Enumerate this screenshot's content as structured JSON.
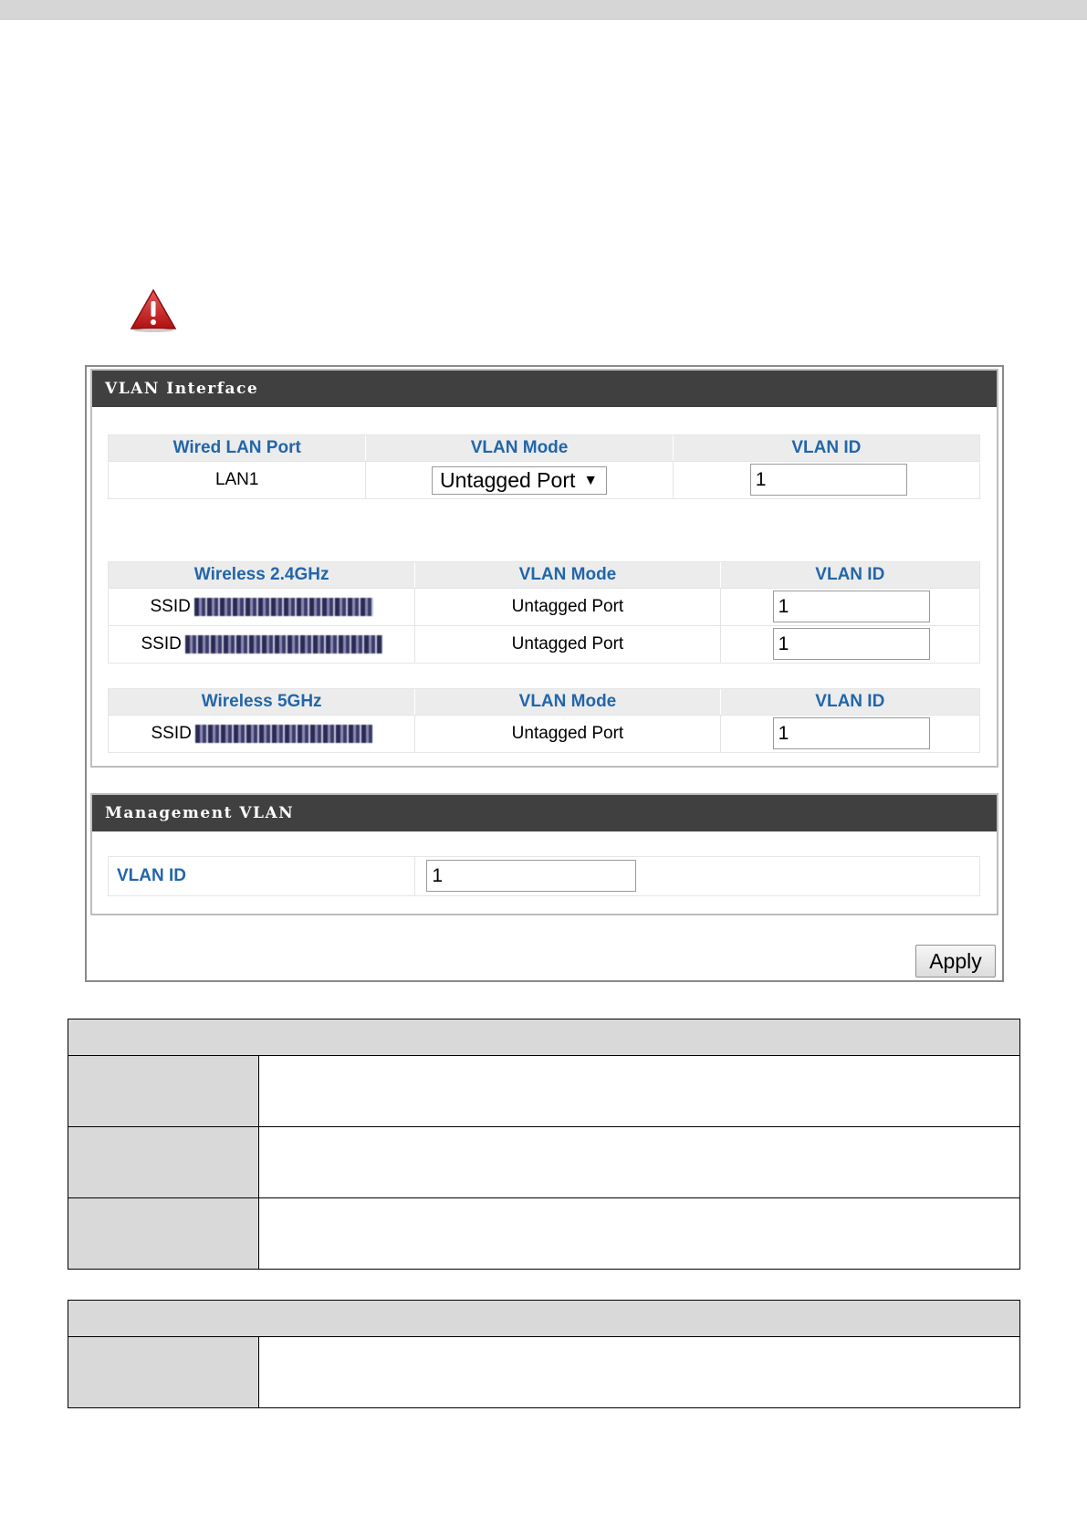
{
  "vlan_interface": {
    "title": "VLAN Interface",
    "wired": {
      "headers": [
        "Wired LAN Port",
        "VLAN Mode",
        "VLAN ID"
      ],
      "rows": [
        {
          "port": "LAN1",
          "mode": "Untagged Port",
          "vlan_id": "1"
        }
      ]
    },
    "wireless_24": {
      "headers": [
        "Wireless 2.4GHz",
        "VLAN Mode",
        "VLAN ID"
      ],
      "rows": [
        {
          "ssid_prefix": "SSID",
          "mode": "Untagged Port",
          "vlan_id": "1"
        },
        {
          "ssid_prefix": "SSID",
          "mode": "Untagged Port",
          "vlan_id": "1"
        }
      ]
    },
    "wireless_5": {
      "headers": [
        "Wireless 5GHz",
        "VLAN Mode",
        "VLAN ID"
      ],
      "rows": [
        {
          "ssid_prefix": "SSID",
          "mode": "Untagged Port",
          "vlan_id": "1"
        }
      ]
    }
  },
  "management_vlan": {
    "title": "Management VLAN",
    "label": "VLAN ID",
    "vlan_id": "1"
  },
  "apply_label": "Apply",
  "icons": {
    "warning": "warning-icon",
    "dropdown": "dropdown-arrow-icon"
  },
  "colors": {
    "header_bar": "#404040",
    "label_blue": "#2266aa",
    "table_header": "#d9d9d9"
  }
}
